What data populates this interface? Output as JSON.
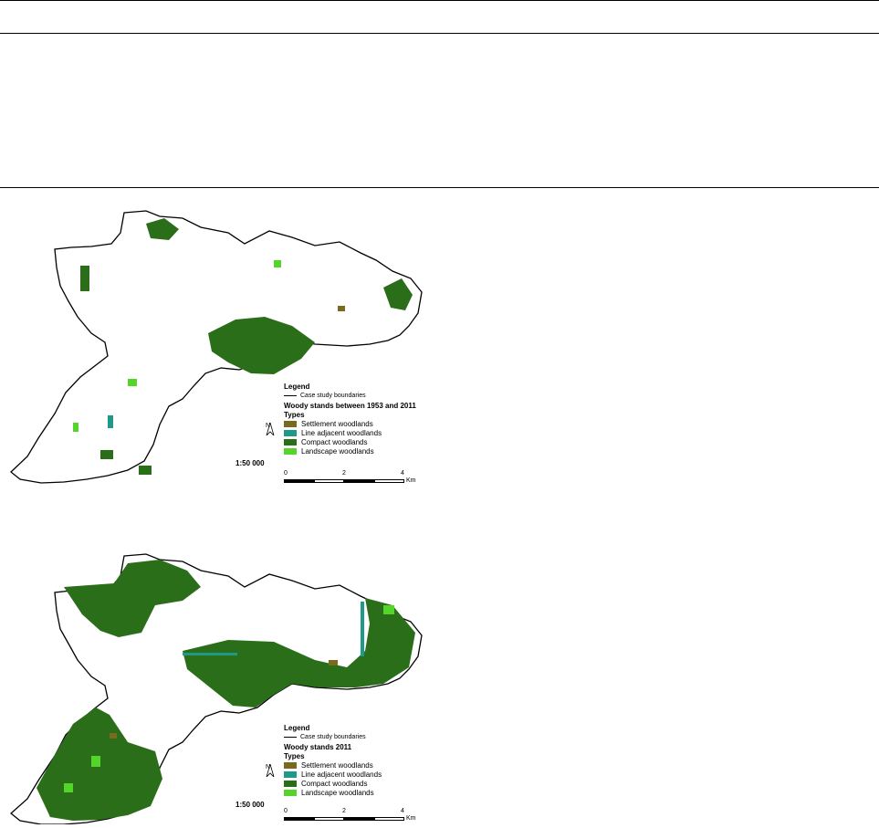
{
  "maps": [
    {
      "legend_title": "Legend",
      "boundary_label": "Case study boundaries",
      "subtitle": "Woody stands between 1953 and 2011",
      "types_label": "Types",
      "items": [
        {
          "label": "Settlement woodlands",
          "color": "#7a6a1f"
        },
        {
          "label": "Line adjacent woodlands",
          "color": "#1f9a8a"
        },
        {
          "label": "Compact woodlands",
          "color": "#2a6e1a"
        },
        {
          "label": "Landscape woodlands",
          "color": "#55d42a"
        }
      ],
      "scale": "1:50 000",
      "north": "N",
      "scale_ticks": [
        "0",
        "2",
        "4"
      ],
      "scale_unit": "Km"
    },
    {
      "legend_title": "Legend",
      "boundary_label": "Case study boundaries",
      "subtitle": "Woody stands 2011",
      "types_label": "Types",
      "items": [
        {
          "label": "Settlement woodlands",
          "color": "#7a6a1f"
        },
        {
          "label": "Line adjacent woodlands",
          "color": "#1f9a8a"
        },
        {
          "label": "Compact woodlands",
          "color": "#2a6e1a"
        },
        {
          "label": "Landscape woodlands",
          "color": "#55d42a"
        }
      ],
      "scale": "1:50 000",
      "north": "N",
      "scale_ticks": [
        "0",
        "2",
        "4"
      ],
      "scale_unit": "Km"
    }
  ]
}
